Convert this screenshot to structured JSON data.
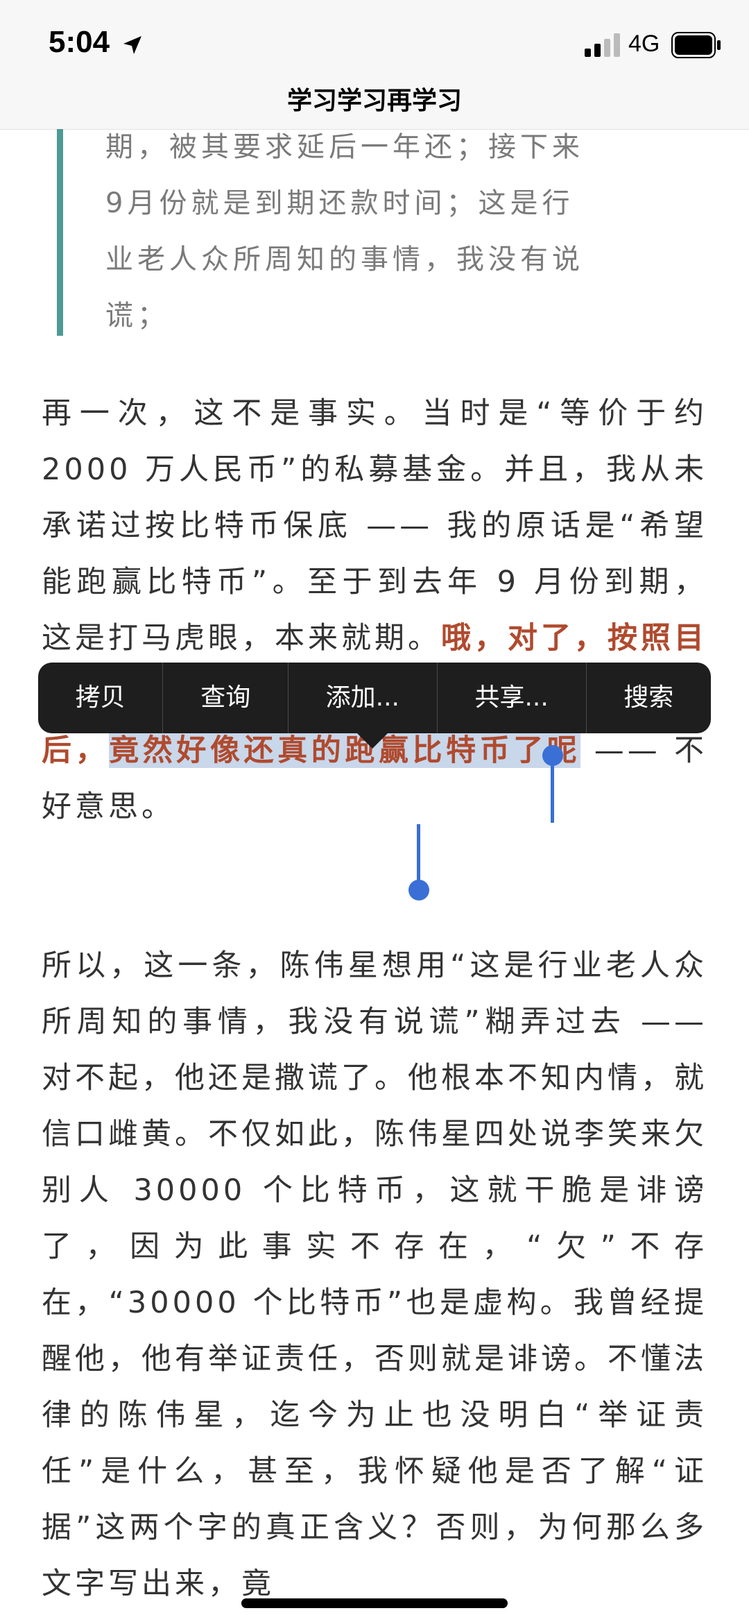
{
  "status_bar": {
    "time": "5:04",
    "network": "4G"
  },
  "nav": {
    "title": "学习学习再学习"
  },
  "quote": {
    "lines": [
      "期，被其要求延后一年还；接下来",
      "9月份就是到期还款时间；这是行",
      "业老人众所周知的事情，我没有说",
      "谎；"
    ]
  },
  "para1": {
    "text": "再一次，这不是事实。当时是“等价于约 2000 万人民币”的私募基金。并且，我从未承诺过按比特币保底 —— 我的原话是“希望能跑赢比特币”。至于到去年 9 月份到期，这是打马虎眼，本来就",
    "hidden_line_start": "期。",
    "emph_plain": "哦，对了，按照目前的业绩来看，在 wrote off 很多项目之后，",
    "emph_selected": "竟然好像还真的跑赢比特币了呢",
    "tail": " —— 不好意思。"
  },
  "para3": {
    "text": "所以，这一条，陈伟星想用“这是行业老人众所周知的事情，我没有说谎”糊弄过去 —— 对不起，他还是撒谎了。他根本不知内情，就信口雌黄。不仅如此，陈伟星四处说李笑来欠别人 30000 个比特币，这就干脆是诽谤了，因为此事实不存在，“欠”不存在，“30000 个比特币”也是虚构。我曾经提醒他，他有举证责任，否则就是诽谤。不懂法律的陈伟星，迄今为止也没明白“举证责任”是什么，甚至，我怀疑他是否了解“证据”这两个字的真正含义？否则，为何那么多文字写出来，竟"
  },
  "context_menu": {
    "items": [
      "拷贝",
      "查询",
      "添加...",
      "共享...",
      "搜索"
    ]
  },
  "colors": {
    "quote_bar": "#4f9a94",
    "emphasis": "#b04a2e",
    "selection": "#c8d7ea",
    "handles": "#3a6fd6"
  }
}
